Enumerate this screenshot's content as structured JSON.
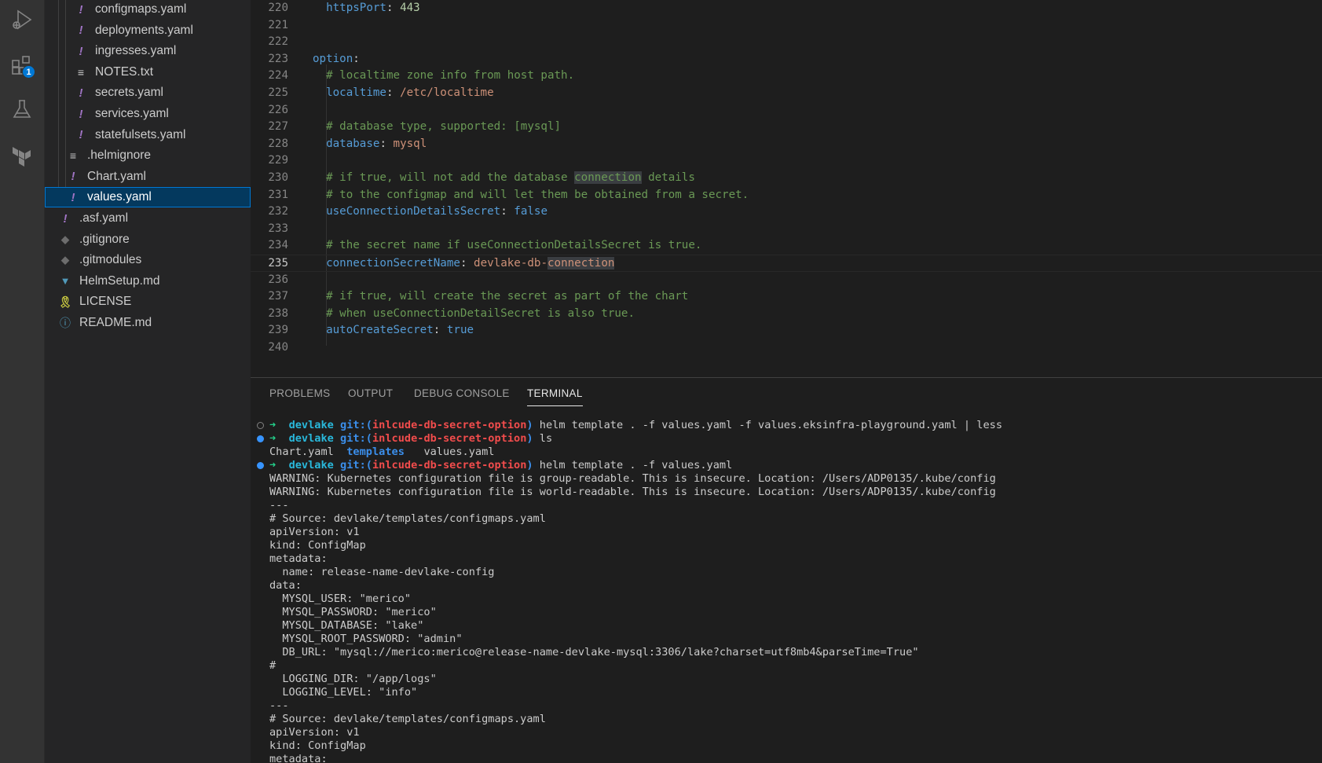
{
  "activity_bar": {
    "extensions_badge": "1"
  },
  "explorer": {
    "items": [
      {
        "label": "configmaps.yaml",
        "icon": "yaml-icon"
      },
      {
        "label": "deployments.yaml",
        "icon": "yaml-icon"
      },
      {
        "label": "ingresses.yaml",
        "icon": "yaml-icon"
      },
      {
        "label": "NOTES.txt",
        "icon": "text-file-icon"
      },
      {
        "label": "secrets.yaml",
        "icon": "yaml-icon"
      },
      {
        "label": "services.yaml",
        "icon": "yaml-icon"
      },
      {
        "label": "statefulsets.yaml",
        "icon": "yaml-icon"
      },
      {
        "label": ".helmignore",
        "icon": "text-file-icon"
      },
      {
        "label": "Chart.yaml",
        "icon": "yaml-icon"
      },
      {
        "label": "values.yaml",
        "icon": "yaml-icon",
        "selected": true
      },
      {
        "label": ".asf.yaml",
        "icon": "yaml-icon"
      },
      {
        "label": ".gitignore",
        "icon": "git-icon"
      },
      {
        "label": ".gitmodules",
        "icon": "git-icon"
      },
      {
        "label": "HelmSetup.md",
        "icon": "markdown-icon"
      },
      {
        "label": "LICENSE",
        "icon": "license-icon"
      },
      {
        "label": "README.md",
        "icon": "info-icon"
      }
    ]
  },
  "editor": {
    "current_line": "235",
    "lines": [
      {
        "num": "220",
        "segments": [
          {
            "t": "  ",
            "c": "p"
          },
          {
            "t": "httpsPort",
            "c": "k"
          },
          {
            "t": ": ",
            "c": "p"
          },
          {
            "t": "443",
            "c": "n"
          }
        ]
      },
      {
        "num": "221",
        "segments": []
      },
      {
        "num": "222",
        "segments": []
      },
      {
        "num": "223",
        "segments": [
          {
            "t": "option",
            "c": "k"
          },
          {
            "t": ":",
            "c": "p"
          }
        ]
      },
      {
        "num": "224",
        "segments": [
          {
            "t": "  ",
            "c": "p"
          },
          {
            "t": "# localtime zone info from host path.",
            "c": "c"
          }
        ]
      },
      {
        "num": "225",
        "segments": [
          {
            "t": "  ",
            "c": "p"
          },
          {
            "t": "localtime",
            "c": "k"
          },
          {
            "t": ": ",
            "c": "p"
          },
          {
            "t": "/etc/localtime",
            "c": "s"
          }
        ]
      },
      {
        "num": "226",
        "segments": []
      },
      {
        "num": "227",
        "segments": [
          {
            "t": "  ",
            "c": "p"
          },
          {
            "t": "# database type, supported: [mysql]",
            "c": "c"
          }
        ]
      },
      {
        "num": "228",
        "segments": [
          {
            "t": "  ",
            "c": "p"
          },
          {
            "t": "database",
            "c": "k"
          },
          {
            "t": ": ",
            "c": "p"
          },
          {
            "t": "mysql",
            "c": "s"
          }
        ]
      },
      {
        "num": "229",
        "segments": []
      },
      {
        "num": "230",
        "segments": [
          {
            "t": "  ",
            "c": "p"
          },
          {
            "t": "# if true, will not add the database ",
            "c": "c"
          },
          {
            "t": "connection",
            "c": "c hl"
          },
          {
            "t": " details",
            "c": "c"
          }
        ]
      },
      {
        "num": "231",
        "segments": [
          {
            "t": "  ",
            "c": "p"
          },
          {
            "t": "# to the configmap and will let them be obtained from a secret.",
            "c": "c"
          }
        ]
      },
      {
        "num": "232",
        "segments": [
          {
            "t": "  ",
            "c": "p"
          },
          {
            "t": "useConnectionDetailsSecret",
            "c": "k"
          },
          {
            "t": ": ",
            "c": "p"
          },
          {
            "t": "false",
            "c": "k"
          }
        ]
      },
      {
        "num": "233",
        "segments": []
      },
      {
        "num": "234",
        "segments": [
          {
            "t": "  ",
            "c": "p"
          },
          {
            "t": "# the secret name if useConnectionDetailsSecret is true.",
            "c": "c"
          }
        ]
      },
      {
        "num": "235",
        "segments": [
          {
            "t": "  ",
            "c": "p"
          },
          {
            "t": "connectionSecretName",
            "c": "k"
          },
          {
            "t": ": ",
            "c": "p"
          },
          {
            "t": "devlake-db-",
            "c": "s"
          },
          {
            "t": "connection",
            "c": "s hl"
          }
        ]
      },
      {
        "num": "236",
        "segments": []
      },
      {
        "num": "237",
        "segments": [
          {
            "t": "  ",
            "c": "p"
          },
          {
            "t": "# if true, will create the secret as part of the chart",
            "c": "c"
          }
        ]
      },
      {
        "num": "238",
        "segments": [
          {
            "t": "  ",
            "c": "p"
          },
          {
            "t": "# when useConnectionDetailSecret is also true.",
            "c": "c"
          }
        ]
      },
      {
        "num": "239",
        "segments": [
          {
            "t": "  ",
            "c": "p"
          },
          {
            "t": "autoCreateSecret",
            "c": "k"
          },
          {
            "t": ": ",
            "c": "p"
          },
          {
            "t": "true",
            "c": "k"
          }
        ]
      },
      {
        "num": "240",
        "segments": []
      }
    ]
  },
  "panel": {
    "tabs": [
      {
        "label": "PROBLEMS"
      },
      {
        "label": "OUTPUT"
      },
      {
        "label": "DEBUG CONSOLE"
      },
      {
        "label": "TERMINAL",
        "active": true
      }
    ]
  },
  "terminal": {
    "lines": [
      {
        "dec": "empty",
        "segments": [
          {
            "t": "➜  ",
            "c": "arrow"
          },
          {
            "t": "devlake ",
            "c": "cyan"
          },
          {
            "t": "git:(",
            "c": "blue"
          },
          {
            "t": "inlcude-db-secret-option",
            "c": "red"
          },
          {
            "t": ")",
            "c": "blue"
          },
          {
            "t": " helm template . -f values.yaml -f values.eksinfra-playground.yaml | less",
            "c": ""
          }
        ]
      },
      {
        "dec": "filled",
        "segments": [
          {
            "t": "➜  ",
            "c": "arrow"
          },
          {
            "t": "devlake ",
            "c": "cyan"
          },
          {
            "t": "git:(",
            "c": "blue"
          },
          {
            "t": "inlcude-db-secret-option",
            "c": "red"
          },
          {
            "t": ")",
            "c": "blue"
          },
          {
            "t": " ls",
            "c": ""
          }
        ]
      },
      {
        "segments": [
          {
            "t": "Chart.yaml  ",
            "c": ""
          },
          {
            "t": "templates",
            "c": "dir"
          },
          {
            "t": "   values.yaml",
            "c": ""
          }
        ]
      },
      {
        "dec": "filled",
        "segments": [
          {
            "t": "➜  ",
            "c": "arrow"
          },
          {
            "t": "devlake ",
            "c": "cyan"
          },
          {
            "t": "git:(",
            "c": "blue"
          },
          {
            "t": "inlcude-db-secret-option",
            "c": "red"
          },
          {
            "t": ")",
            "c": "blue"
          },
          {
            "t": " helm template . -f values.yaml",
            "c": ""
          }
        ]
      },
      {
        "segments": [
          {
            "t": "WARNING: Kubernetes configuration file is group-readable. This is insecure. Location: /Users/ADP0135/.kube/config",
            "c": ""
          }
        ]
      },
      {
        "segments": [
          {
            "t": "WARNING: Kubernetes configuration file is world-readable. This is insecure. Location: /Users/ADP0135/.kube/config",
            "c": ""
          }
        ]
      },
      {
        "segments": [
          {
            "t": "---",
            "c": ""
          }
        ]
      },
      {
        "segments": [
          {
            "t": "# Source: devlake/templates/configmaps.yaml",
            "c": ""
          }
        ]
      },
      {
        "segments": [
          {
            "t": "apiVersion: v1",
            "c": ""
          }
        ]
      },
      {
        "segments": [
          {
            "t": "kind: ConfigMap",
            "c": ""
          }
        ]
      },
      {
        "segments": [
          {
            "t": "metadata:",
            "c": ""
          }
        ]
      },
      {
        "segments": [
          {
            "t": "  name: release-name-devlake-config",
            "c": ""
          }
        ]
      },
      {
        "segments": [
          {
            "t": "data:",
            "c": ""
          }
        ]
      },
      {
        "segments": [
          {
            "t": "  MYSQL_USER: \"merico\"",
            "c": ""
          }
        ]
      },
      {
        "segments": [
          {
            "t": "  MYSQL_PASSWORD: \"merico\"",
            "c": ""
          }
        ]
      },
      {
        "segments": [
          {
            "t": "  MYSQL_DATABASE: \"lake\"",
            "c": ""
          }
        ]
      },
      {
        "segments": [
          {
            "t": "  MYSQL_ROOT_PASSWORD: \"admin\"",
            "c": ""
          }
        ]
      },
      {
        "segments": [
          {
            "t": "  DB_URL: \"mysql://merico:merico@release-name-devlake-mysql:3306/lake?charset=utf8mb4&parseTime=True\"",
            "c": ""
          }
        ]
      },
      {
        "segments": [
          {
            "t": "#",
            "c": ""
          }
        ]
      },
      {
        "segments": [
          {
            "t": "  LOGGING_DIR: \"/app/logs\"",
            "c": ""
          }
        ]
      },
      {
        "segments": [
          {
            "t": "  LOGGING_LEVEL: \"info\"",
            "c": ""
          }
        ]
      },
      {
        "segments": [
          {
            "t": "---",
            "c": ""
          }
        ]
      },
      {
        "segments": [
          {
            "t": "# Source: devlake/templates/configmaps.yaml",
            "c": ""
          }
        ]
      },
      {
        "segments": [
          {
            "t": "apiVersion: v1",
            "c": ""
          }
        ]
      },
      {
        "segments": [
          {
            "t": "kind: ConfigMap",
            "c": ""
          }
        ]
      },
      {
        "segments": [
          {
            "t": "metadata:",
            "c": ""
          }
        ]
      }
    ]
  }
}
